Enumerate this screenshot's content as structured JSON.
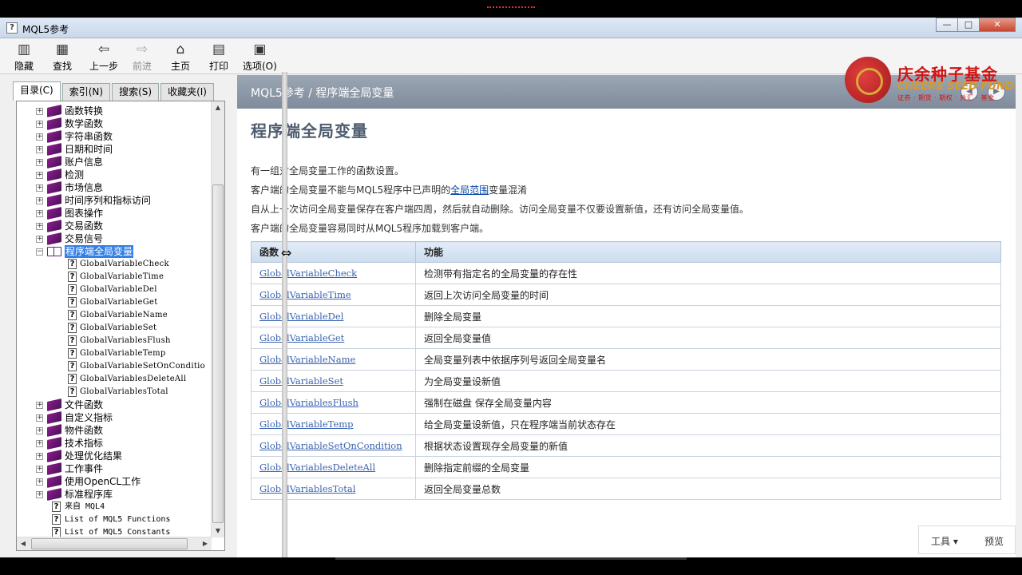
{
  "window": {
    "title": "MQL5参考",
    "buttons": [
      "—",
      "□",
      "✕"
    ]
  },
  "toolbar": {
    "items": [
      {
        "label": "隐藏",
        "icon": "hide-panel-icon",
        "glyph": "▥"
      },
      {
        "label": "查找",
        "icon": "find-icon",
        "glyph": "▦"
      },
      {
        "label": "上一步",
        "icon": "back-arrow-icon",
        "glyph": "⇦"
      },
      {
        "label": "前进",
        "icon": "forward-arrow-icon",
        "glyph": "⇨"
      },
      {
        "label": "主页",
        "icon": "home-icon",
        "glyph": "⌂"
      },
      {
        "label": "打印",
        "icon": "print-icon",
        "glyph": "▤"
      },
      {
        "label": "选项(O)",
        "icon": "options-icon",
        "glyph": "▣"
      }
    ]
  },
  "tabs": [
    "目录(C)",
    "索引(N)",
    "搜索(S)",
    "收藏夹(I)"
  ],
  "tree": {
    "groups_before": [
      "函数转换",
      "数学函数",
      "字符串函数",
      "日期和时间",
      "账户信息",
      "检测",
      "市场信息",
      "时间序列和指标访问",
      "图表操作",
      "交易函数",
      "交易信号"
    ],
    "selected": "程序端全局变量",
    "children": [
      "GlobalVariableCheck",
      "GlobalVariableTime",
      "GlobalVariableDel",
      "GlobalVariableGet",
      "GlobalVariableName",
      "GlobalVariableSet",
      "GlobalVariablesFlush",
      "GlobalVariableTemp",
      "GlobalVariableSetOnConditio",
      "GlobalVariablesDeleteAll",
      "GlobalVariablesTotal"
    ],
    "groups_after": [
      "文件函数",
      "自定义指标",
      "物件函数",
      "技术指标",
      "处理优化结果",
      "工作事件",
      "使用OpenCL工作",
      "标准程序库"
    ],
    "leaves_after": [
      "来自 MQL4",
      "List of MQL5 Functions",
      "List of MQL5 Constants"
    ]
  },
  "doc": {
    "breadcrumb": "MQL5参考 / 程序端全局变量",
    "title": "程序端全局变量",
    "p1": "有一组对全局变量工作的函数设置。",
    "p2_before": "客户端的全局变量不能与MQL5程序中已声明的",
    "p2_link": "全局范围",
    "p2_after": "变量混淆",
    "p3": "自从上一次访问全局变量保存在客户端四周，然后就自动删除。访问全局变量不仅要设置新值，还有访问全局变量值。",
    "p4": "客户端的全局变量容易同时从MQL5程序加载到客户端。",
    "table_headers": [
      "函数",
      "功能"
    ],
    "rows": [
      {
        "fn": "GlobalVariableCheck",
        "desc": "检测带有指定名的全局变量的存在性"
      },
      {
        "fn": "GlobalVariableTime",
        "desc": "返回上次访问全局变量的时间"
      },
      {
        "fn": "GlobalVariableDel",
        "desc": "删除全局变量"
      },
      {
        "fn": "GlobalVariableGet",
        "desc": "返回全局变量值"
      },
      {
        "fn": "GlobalVariableName",
        "desc": "全局变量列表中依据序列号返回全局变量名"
      },
      {
        "fn": "GlobalVariableSet",
        "desc": "为全局变量设新值"
      },
      {
        "fn": "GlobalVariablesFlush",
        "desc": "强制在磁盘 保存全局变量内容"
      },
      {
        "fn": "GlobalVariableTemp",
        "desc": "给全局变量设新值，只在程序端当前状态存在"
      },
      {
        "fn": "GlobalVariableSetOnCondition",
        "desc": "根据状态设置现存全局变量的新值"
      },
      {
        "fn": "GlobalVariablesDeleteAll",
        "desc": "删除指定前缀的全局变量"
      },
      {
        "fn": "GlobalVariablesTotal",
        "desc": "返回全局变量总数"
      }
    ]
  },
  "bottom_tools": {
    "tools": "工具 ▾",
    "preview": "预览"
  },
  "logo": {
    "cn": "庆余种子基金",
    "en": "CHEERS SEED FUND",
    "slogan": "证券 · 期货 · 期权 · 外汇 · 基金"
  }
}
